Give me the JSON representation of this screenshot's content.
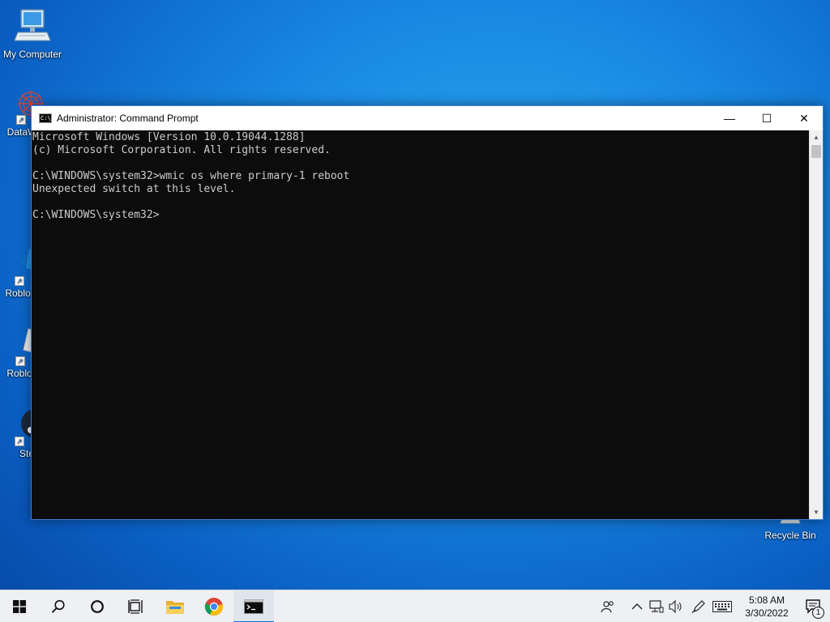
{
  "desktop": {
    "icons": [
      {
        "label": "My Computer",
        "icon": "computer-icon"
      },
      {
        "label": "DataW",
        "icon": "datawrapper-icon"
      },
      {
        "label": "Roblox",
        "icon": "roblox-studio-icon"
      },
      {
        "label": "Roblox",
        "icon": "roblox-player-icon"
      },
      {
        "label": "Ste",
        "icon": "steam-icon"
      },
      {
        "label": "Recycle Bin",
        "icon": "recycle-bin-icon"
      }
    ]
  },
  "window": {
    "title": "Administrator: Command Prompt",
    "icon_text": "C:\\_",
    "controls": {
      "minimize": "—",
      "maximize": "☐",
      "close": "✕"
    },
    "console_lines": [
      "Microsoft Windows [Version 10.0.19044.1288]",
      "(c) Microsoft Corporation. All rights reserved.",
      "",
      "C:\\WINDOWS\\system32>wmic os where primary-1 reboot",
      "Unexpected switch at this level.",
      "",
      "C:\\WINDOWS\\system32>"
    ],
    "colors": {
      "console_bg": "#0c0c0c",
      "console_text": "#cccccc",
      "border": "#3b7ed8"
    }
  },
  "taskbar": {
    "buttons": [
      {
        "name": "start",
        "icon": "windows-logo-icon"
      },
      {
        "name": "search",
        "icon": "search-icon"
      },
      {
        "name": "cortana",
        "icon": "cortana-circle-icon"
      },
      {
        "name": "task-view",
        "icon": "task-view-icon"
      },
      {
        "name": "file-explorer",
        "icon": "folder-icon"
      },
      {
        "name": "chrome",
        "icon": "chrome-icon"
      },
      {
        "name": "command-prompt",
        "icon": "cmd-icon",
        "active": true
      }
    ],
    "tray": {
      "icons": [
        "people-icon",
        "chevron-up-icon",
        "network-icon",
        "volume-icon",
        "pen-icon",
        "keyboard-icon"
      ],
      "time": "5:08 AM",
      "date": "3/30/2022",
      "notification_count": "1"
    },
    "accent": "#0a74d9"
  }
}
